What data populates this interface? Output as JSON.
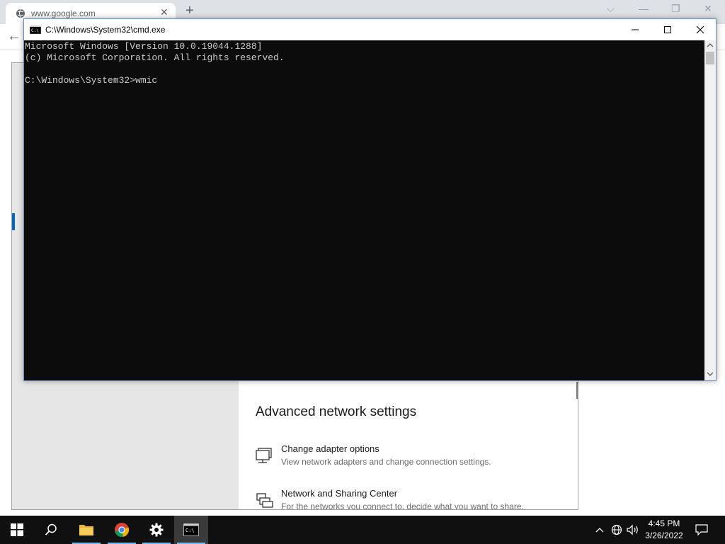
{
  "browser": {
    "tab_title": "www.google.com",
    "tab_close": "✕",
    "new_tab": "+",
    "controls": {
      "dropdown": "⌵",
      "minimize": "—",
      "restore": "❐",
      "close": "✕"
    },
    "back": "←"
  },
  "settings": {
    "section_title": "Advanced network settings",
    "options": [
      {
        "title": "Change adapter options",
        "description": "View network adapters and change connection settings.",
        "icon": "monitor-network-icon"
      },
      {
        "title": "Network and Sharing Center",
        "description": "For the networks you connect to, decide what you want to share.",
        "icon": "printer-network-icon"
      }
    ]
  },
  "cmd": {
    "title": "C:\\Windows\\System32\\cmd.exe",
    "lines": [
      "Microsoft Windows [Version 10.0.19044.1288]",
      "(c) Microsoft Corporation. All rights reserved.",
      "",
      "C:\\Windows\\System32>wmic"
    ],
    "colors": {
      "background": "#0c0c0c",
      "text": "#cccccc"
    }
  },
  "taskbar": {
    "apps": [
      "start-icon",
      "search-icon",
      "file-explorer-icon",
      "chrome-icon",
      "settings-gear-icon",
      "cmd-icon"
    ],
    "active_app": "cmd-icon",
    "clock": {
      "time": "4:45 PM",
      "date": "3/26/2022"
    },
    "accent": "#76b9ed"
  }
}
